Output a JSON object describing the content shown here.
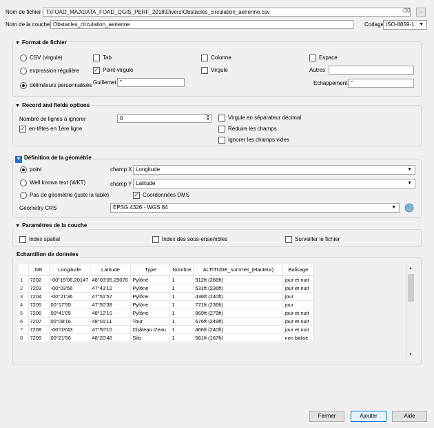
{
  "file": {
    "label": "Nom de fichier",
    "value": "T:\\FOAD_MAJ\\DATA_FOAD_QGIS_PERF_2018\\Divers\\Obstacles_circulation_aerienne.csv",
    "clear_icon": "⌫",
    "browse_label": "..."
  },
  "layer": {
    "label": "Nom de la couche",
    "value": "Obstacles_circulation_aerienne",
    "encoding_label": "Codage",
    "encoding_value": "ISO-8859-1"
  },
  "format": {
    "title": "Format de fichier",
    "csv": "CSV (virgule)",
    "regex": "expression régulière",
    "custom": "délimiteurs personnalisés",
    "tab": "Tab",
    "semicolon": "Point-virgule",
    "colon": "Colonne",
    "comma": "Virgule",
    "space": "Espace",
    "others": "Autres",
    "quote_label": "Guillemet",
    "quote_value": "\"",
    "escape_label": "Echappement",
    "escape_value": "\""
  },
  "record": {
    "title": "Record and fields options",
    "skip_label": "Nombre de lignes à ignorer",
    "skip_value": "0",
    "headers": "en-têtes en 1ère ligne",
    "decimal_comma": "Virgule en séparateur décimal",
    "trim": "Réduire les champs",
    "discard_empty": "Ignorer les champs vides"
  },
  "geometry": {
    "title": "Définition de la géométrie",
    "point": "point",
    "wkt": "Well known text (WKT)",
    "none": "Pas de géométrie (juste la table)",
    "x_label": "champ X",
    "x_value": "Longitude",
    "y_label": "champ Y",
    "y_value": "Latitude",
    "dms": "Coordonnées DMS",
    "crs_label": "Geometry CRS",
    "crs_value": "EPSG:4326 - WGS 84"
  },
  "layer_settings": {
    "title": "Paramètres de la couche",
    "spatial_index": "Index spatial",
    "subset_index": "Index des sous-ensembles",
    "watch_file": "Surveiller le fichier"
  },
  "sample": {
    "title": "Echantillon de données",
    "columns": [
      "NR",
      "Longitude",
      "Latitude",
      "Type",
      "Nombre",
      "ALTITUDE_sommet_(Hauteur)",
      "Balisage"
    ],
    "rows": [
      [
        "1",
        "7202",
        "-00°15'06.20147",
        "48°03'05.25076",
        "Pylône",
        "1",
        "912ft (266ft)",
        "jour et nuit"
      ],
      [
        "2",
        "7203",
        "-00°03'56",
        "47°43'12",
        "Pylône",
        "1",
        "531ft (236ft)",
        "jour et nuit"
      ],
      [
        "3",
        "7204",
        "-00°21'36",
        "47°51'57",
        "Pylône",
        "1",
        "436ft (240ft)",
        "jour"
      ],
      [
        "4",
        "7205",
        "00°17'55",
        "47°50'38",
        "Pylône",
        "1",
        "771ft (236ft)",
        "jour"
      ],
      [
        "5",
        "7206",
        "00°41'05",
        "48°12'10",
        "Pylône",
        "1",
        "869ft (279ft)",
        "jour et nuit"
      ],
      [
        "6",
        "7207",
        "00°08'16",
        "48°01'11",
        "Tour",
        "1",
        "676ft (249ft)",
        "jour et nuit"
      ],
      [
        "7",
        "7208",
        "-00°03'43",
        "47°50'10",
        "Château d'eau",
        "1",
        "466ft (240ft)",
        "jour et nuit"
      ],
      [
        "8",
        "7209",
        "00°21'56",
        "48°20'46",
        "Silo",
        "1",
        "561ft (167ft)",
        "non balisé"
      ]
    ]
  },
  "buttons": {
    "close": "Fermer",
    "add": "Ajouter",
    "help": "Aide"
  }
}
